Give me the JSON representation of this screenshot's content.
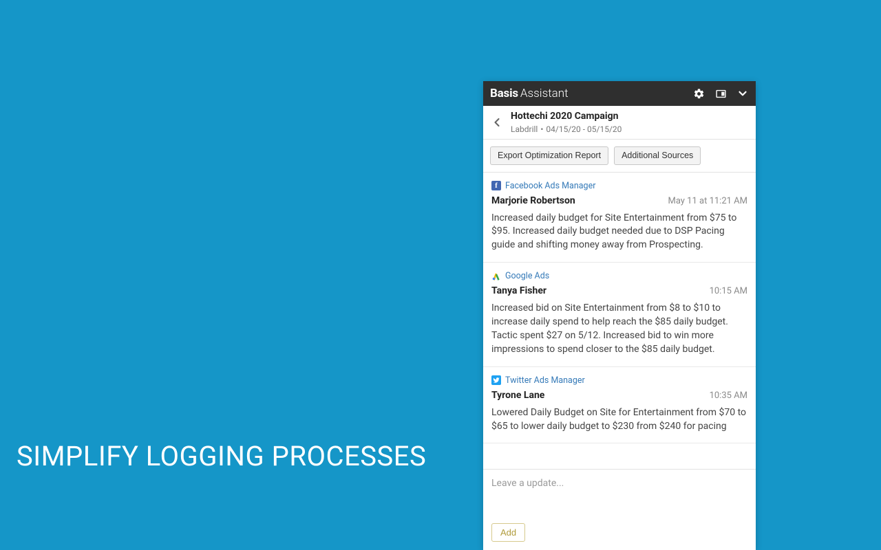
{
  "headline": "SIMPLIFY LOGGING PROCESSES",
  "titlebar": {
    "brand_strong": "Basis",
    "brand_light": "Assistant"
  },
  "campaign": {
    "title": "Hottechi 2020 Campaign",
    "advertiser": "Labdrill",
    "daterange": "04/15/20 - 05/15/20"
  },
  "actions": {
    "export": "Export Optimization Report",
    "additional": "Additional Sources"
  },
  "entries": [
    {
      "source_icon": "facebook-icon",
      "source": "Facebook Ads Manager",
      "author": "Marjorie Robertson",
      "time": "May 11 at 11:21 AM",
      "body": "Increased daily budget for Site Entertainment from $75 to $95. Increased daily budget needed due to DSP Pacing guide and shifting money away from Prospecting."
    },
    {
      "source_icon": "google-ads-icon",
      "source": "Google Ads",
      "author": "Tanya Fisher",
      "time": "10:15 AM",
      "body": "Increased bid on Site Entertainment from $8 to $10 to increase daily spend to help reach the $85 daily budget. Tactic spent $27 on 5/12. Increased bid to win more impressions to spend closer to the $85 daily budget."
    },
    {
      "source_icon": "twitter-icon",
      "source": "Twitter Ads Manager",
      "author": "Tyrone Lane",
      "time": "10:35 AM",
      "body": "Lowered Daily Budget on Site for Entertainment from $70 to $65 to lower daily budget to $230 from $240 for pacing"
    }
  ],
  "composer": {
    "placeholder": "Leave a update...",
    "add": "Add"
  }
}
